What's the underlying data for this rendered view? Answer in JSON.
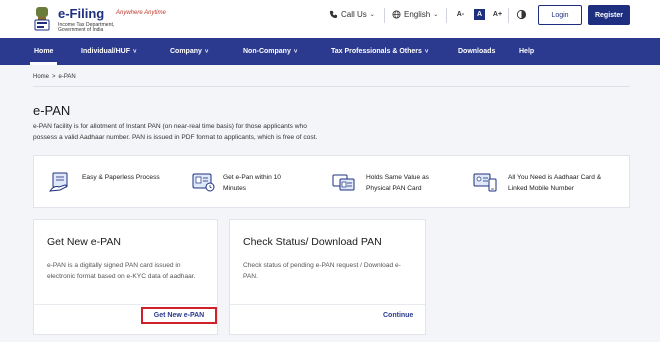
{
  "header": {
    "logo_title": "e-Filing",
    "logo_tagline": "Anywhere Anytime",
    "logo_sub1": "Income Tax Department,",
    "logo_sub2": "Government of India",
    "call_us": "Call Us",
    "language": "English",
    "font_small": "A-",
    "font_normal": "A",
    "font_large": "A+",
    "login": "Login",
    "register": "Register"
  },
  "nav": {
    "items": [
      {
        "label": "Home"
      },
      {
        "label": "Individual/HUF"
      },
      {
        "label": "Company"
      },
      {
        "label": "Non-Company"
      },
      {
        "label": "Tax Professionals & Others"
      },
      {
        "label": "Downloads"
      },
      {
        "label": "Help"
      }
    ]
  },
  "breadcrumb": {
    "home": "Home",
    "sep": ">",
    "current": "e-PAN"
  },
  "page": {
    "title": "e-PAN",
    "description": "e-PAN facility is for allotment of Instant PAN (on near-real time basis) for those applicants who possess a valid Aadhaar number. PAN is issued in PDF format to applicants, which is free of cost."
  },
  "features": [
    {
      "line1": "Easy & Paperless Process",
      "line2": ""
    },
    {
      "line1": "Get e-Pan within 10",
      "line2": "Minutes"
    },
    {
      "line1": "Holds Same Value as",
      "line2": "Physical PAN Card"
    },
    {
      "line1": "All You Need is Aadhaar Card &",
      "line2": "Linked Mobile Number"
    }
  ],
  "cards": {
    "new_epan": {
      "title": "Get New e-PAN",
      "desc": "e-PAN is a digitally signed PAN card issued in electronic format based on e-KYC data of aadhaar.",
      "link": "Get New e-PAN"
    },
    "status": {
      "title": "Check Status/ Download PAN",
      "desc": "Check status of pending e-PAN request / Download e-PAN.",
      "link": "Continue"
    }
  },
  "colors": {
    "primary": "#2b3a8f",
    "highlight": "#d0202a"
  }
}
